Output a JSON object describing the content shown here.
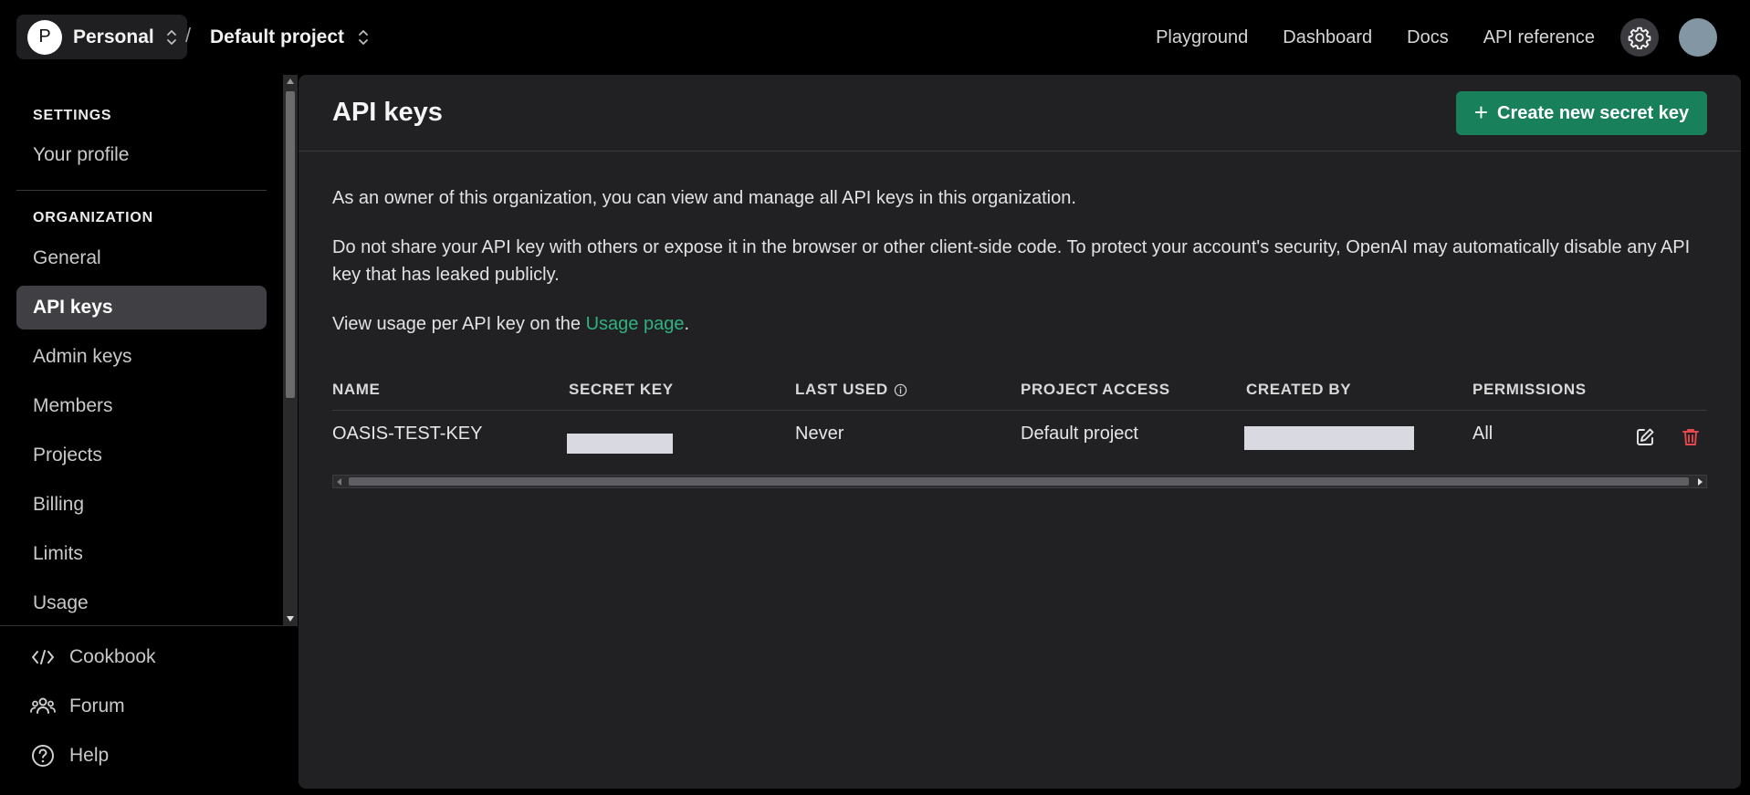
{
  "header": {
    "org_initial": "P",
    "org_name": "Personal",
    "separator": "/",
    "project_name": "Default project",
    "nav": [
      "Playground",
      "Dashboard",
      "Docs",
      "API reference"
    ],
    "icons": [
      "chevron-updown-icon",
      "gear-icon",
      "user-avatar"
    ]
  },
  "sidebar": {
    "settings_title": "SETTINGS",
    "settings_items": [
      "Your profile"
    ],
    "org_title": "ORGANIZATION",
    "org_items": [
      "General",
      "API keys",
      "Admin keys",
      "Members",
      "Projects",
      "Billing",
      "Limits",
      "Usage"
    ],
    "active_item": "API keys",
    "bottom_items": [
      {
        "label": "Cookbook",
        "icon": "code-icon"
      },
      {
        "label": "Forum",
        "icon": "users-icon"
      },
      {
        "label": "Help",
        "icon": "help-icon"
      }
    ]
  },
  "main": {
    "title": "API keys",
    "create_button": "Create new secret key",
    "para1": "As an owner of this organization, you can view and manage all API keys in this organization.",
    "para2": "Do not share your API key with others or expose it in the browser or other client-side code. To protect your account's security, OpenAI may automatically disable any API key that has leaked publicly.",
    "para3_prefix": "View usage per API key on the ",
    "para3_link": "Usage page",
    "para3_suffix": ".",
    "table": {
      "columns": [
        "NAME",
        "SECRET KEY",
        "LAST USED",
        "PROJECT ACCESS",
        "CREATED BY",
        "PERMISSIONS"
      ],
      "rows": [
        {
          "name": "OASIS-TEST-KEY",
          "last_used": "Never",
          "project_access": "Default project",
          "permissions": "All"
        }
      ]
    }
  },
  "colors": {
    "accent_green": "#19805c",
    "link_green": "#2fb27f",
    "delete_red": "#e5484d",
    "panel_bg": "#212124"
  }
}
